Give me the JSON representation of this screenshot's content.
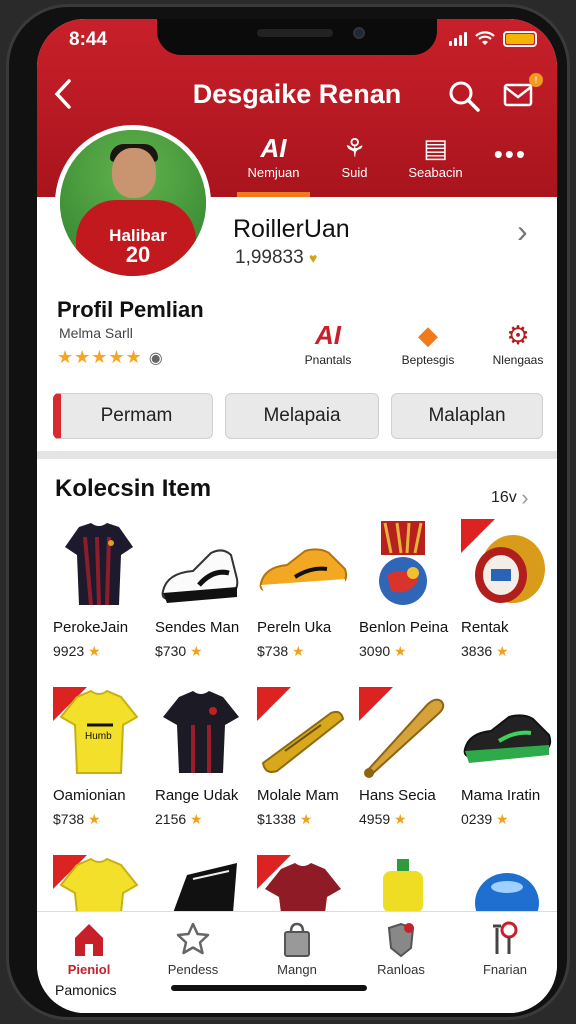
{
  "status": {
    "time": "8:44"
  },
  "header": {
    "title": "Desgaike Renan"
  },
  "tabs": [
    {
      "icon": "AI",
      "label": "Nemjuan"
    },
    {
      "icon": "⚘",
      "label": "Suid"
    },
    {
      "icon": "▤",
      "label": "Seabacin"
    }
  ],
  "avatar": {
    "jersey_text": "Halibar",
    "jersey_number": "20"
  },
  "profile": {
    "name": "RoillerUan",
    "score": "1,99833",
    "title": "Profil Pemlian",
    "subtitle": "Melma Sarll",
    "rating": "★★★★★"
  },
  "quick_actions": [
    {
      "icon": "AI",
      "label": "Pnantals"
    },
    {
      "icon": "◆",
      "label": "Beptesgis"
    },
    {
      "icon": "⚙",
      "label": "Nlengaas"
    }
  ],
  "buttons": [
    {
      "label": "Permam"
    },
    {
      "label": "Melapaia"
    },
    {
      "label": "Malaplan"
    }
  ],
  "collection": {
    "title": "Kolecsin Item",
    "more_label": "16v",
    "items": [
      {
        "name": "PerokeJain",
        "price": "9923"
      },
      {
        "name": "Sendes Man",
        "price": "$730"
      },
      {
        "name": "Pereln Uka",
        "price": "$738"
      },
      {
        "name": "Benlon Peina",
        "price": "3090"
      },
      {
        "name": "Rentak",
        "price": "3836"
      },
      {
        "name": "Oamionian",
        "price": "$738"
      },
      {
        "name": "Range Udak",
        "price": "2156"
      },
      {
        "name": "Molale Mam",
        "price": "$1338"
      },
      {
        "name": "Hans Secia",
        "price": "4959"
      },
      {
        "name": "Mama Iratin",
        "price": "0239"
      }
    ]
  },
  "bottom_nav": {
    "items": [
      {
        "label": "Pieniol"
      },
      {
        "label": "Pendess"
      },
      {
        "label": "Mangn"
      },
      {
        "label": "Ranloas"
      },
      {
        "label": "Fnarian"
      }
    ],
    "extra_label": "Pamonics"
  },
  "colors": {
    "brand_red": "#c8202a",
    "accent_orange": "#f07b1e",
    "star_gold": "#f5a623"
  }
}
